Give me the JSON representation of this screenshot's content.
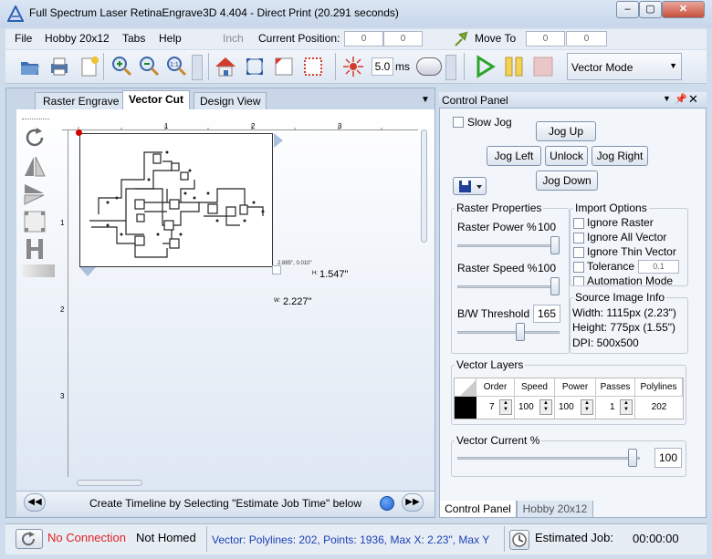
{
  "window": {
    "title": "Full Spectrum Laser RetinaEngrave3D 4.404 - Direct Print (20.291 seconds)"
  },
  "menu": {
    "file": "File",
    "hobby": "Hobby 20x12",
    "tabs": "Tabs",
    "help": "Help",
    "unit": "Inch",
    "current_position_label": "Current Position:",
    "pos_x": "0",
    "pos_y": "0",
    "move_to_label": "Move To",
    "move_x": "0",
    "move_y": "0"
  },
  "toolbar": {
    "duration_value": "5.0",
    "duration_unit": "ms",
    "mode": "Vector Mode"
  },
  "tabs": {
    "raster": "Raster Engrave",
    "vector": "Vector Cut",
    "design": "Design View"
  },
  "ruler": {
    "h": [
      "1",
      "2",
      "3"
    ],
    "v": [
      "1",
      "2",
      "3"
    ]
  },
  "canvas": {
    "coord_readout": "2.885\", 0.010\"",
    "height_label": "H:",
    "height_value": "1.547\"",
    "width_label": "W:",
    "width_value": "2.227\""
  },
  "timeline": {
    "message": "Create Timeline by Selecting \"Estimate Job Time\" below"
  },
  "control_panel": {
    "title": "Control Panel",
    "slow_jog": "Slow Jog",
    "jog_up": "Jog Up",
    "jog_left": "Jog Left",
    "unlock": "Unlock",
    "jog_right": "Jog Right",
    "jog_down": "Jog Down",
    "raster_props_title": "Raster Properties",
    "raster_power_label": "Raster Power %",
    "raster_power": "100",
    "raster_speed_label": "Raster Speed %",
    "raster_speed": "100",
    "bw_threshold_label": "B/W Threshold",
    "bw_threshold": "165",
    "import_title": "Import Options",
    "ignore_raster": "Ignore Raster",
    "ignore_all_vector": "Ignore All Vector",
    "ignore_thin_vector": "Ignore Thin Vector",
    "tolerance": "Tolerance",
    "tolerance_value": "0.1",
    "automation_mode": "Automation Mode",
    "source_title": "Source Image Info",
    "width_info": "Width:  1115px (2.23\")",
    "height_info": "Height: 775px (1.55\")",
    "dpi_info": "DPI: 500x500",
    "vector_layers_title": "Vector Layers",
    "layer_headers": [
      "Order",
      "Speed",
      "Power",
      "Passes",
      "Polylines"
    ],
    "layer_row": {
      "order": "7",
      "speed": "100",
      "power": "100",
      "passes": "1",
      "polylines": "202",
      "color": "#000000"
    },
    "vector_current_title": "Vector Current %",
    "vector_current": "100"
  },
  "bottom_tabs": {
    "control": "Control Panel",
    "hobby": "Hobby 20x12"
  },
  "status": {
    "connection": "No Connection",
    "homed": "Not Homed",
    "vector_info": "Vector: Polylines: 202, Points: 1936, Max X: 2.23\", Max Y",
    "estimated_label": "Estimated Job:",
    "estimated_value": "00:00:00"
  },
  "colors": {
    "connection": "#e02020",
    "vector_info": "#1a3fb5"
  }
}
